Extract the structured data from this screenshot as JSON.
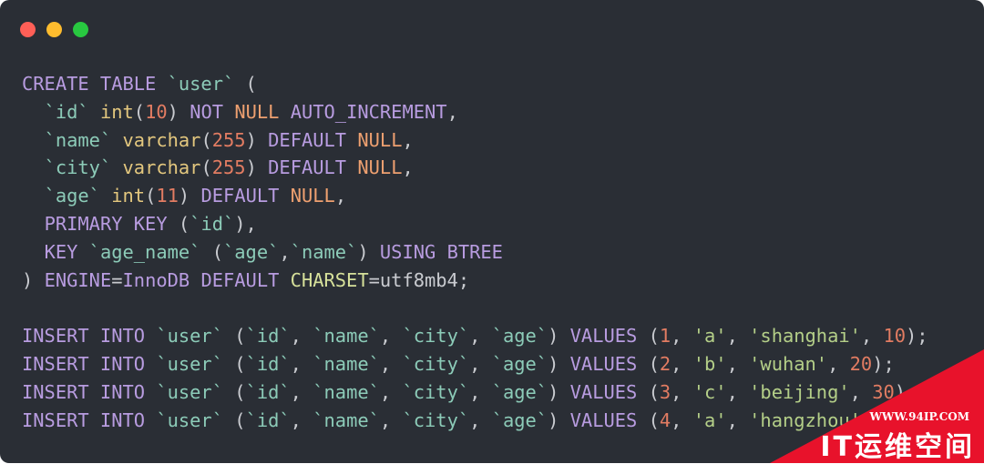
{
  "window": {
    "controls": [
      {
        "name": "close",
        "color": "#ff5f57"
      },
      {
        "name": "minimize",
        "color": "#febc2e"
      },
      {
        "name": "maximize",
        "color": "#28c840"
      }
    ]
  },
  "code": [
    [
      [
        "kw",
        "CREATE TABLE "
      ],
      [
        "id",
        "`user`"
      ],
      [
        "p",
        " ("
      ]
    ],
    [
      [
        "p",
        "  "
      ],
      [
        "id",
        "`id`"
      ],
      [
        "p",
        " "
      ],
      [
        "ty",
        "int"
      ],
      [
        "p",
        "("
      ],
      [
        "num",
        "10"
      ],
      [
        "p",
        ") "
      ],
      [
        "kw",
        "NOT "
      ],
      [
        "nul",
        "NULL"
      ],
      [
        "kw",
        " AUTO_INCREMENT"
      ],
      [
        "p",
        ","
      ]
    ],
    [
      [
        "p",
        "  "
      ],
      [
        "id",
        "`name`"
      ],
      [
        "p",
        " "
      ],
      [
        "ty",
        "varchar"
      ],
      [
        "p",
        "("
      ],
      [
        "num",
        "255"
      ],
      [
        "p",
        ") "
      ],
      [
        "kw",
        "DEFAULT "
      ],
      [
        "nul",
        "NULL"
      ],
      [
        "p",
        ","
      ]
    ],
    [
      [
        "p",
        "  "
      ],
      [
        "id",
        "`city`"
      ],
      [
        "p",
        " "
      ],
      [
        "ty",
        "varchar"
      ],
      [
        "p",
        "("
      ],
      [
        "num",
        "255"
      ],
      [
        "p",
        ") "
      ],
      [
        "kw",
        "DEFAULT "
      ],
      [
        "nul",
        "NULL"
      ],
      [
        "p",
        ","
      ]
    ],
    [
      [
        "p",
        "  "
      ],
      [
        "id",
        "`age`"
      ],
      [
        "p",
        " "
      ],
      [
        "ty",
        "int"
      ],
      [
        "p",
        "("
      ],
      [
        "num",
        "11"
      ],
      [
        "p",
        ") "
      ],
      [
        "kw",
        "DEFAULT "
      ],
      [
        "nul",
        "NULL"
      ],
      [
        "p",
        ","
      ]
    ],
    [
      [
        "p",
        "  "
      ],
      [
        "kw",
        "PRIMARY KEY"
      ],
      [
        "p",
        " ("
      ],
      [
        "id",
        "`id`"
      ],
      [
        "p",
        "),"
      ]
    ],
    [
      [
        "p",
        "  "
      ],
      [
        "kw",
        "KEY "
      ],
      [
        "id",
        "`age_name`"
      ],
      [
        "p",
        " ("
      ],
      [
        "id",
        "`age`"
      ],
      [
        "p",
        ","
      ],
      [
        "id",
        "`name`"
      ],
      [
        "p",
        ") "
      ],
      [
        "kw",
        "USING BTREE"
      ]
    ],
    [
      [
        "p",
        ") "
      ],
      [
        "kw",
        "ENGINE"
      ],
      [
        "p",
        "="
      ],
      [
        "kw",
        "InnoDB DEFAULT "
      ],
      [
        "cs",
        "CHARSET"
      ],
      [
        "p",
        "=utf8mb4;"
      ]
    ],
    [],
    [
      [
        "kw",
        "INSERT INTO "
      ],
      [
        "id",
        "`user`"
      ],
      [
        "p",
        " ("
      ],
      [
        "id",
        "`id`"
      ],
      [
        "p",
        ", "
      ],
      [
        "id",
        "`name`"
      ],
      [
        "p",
        ", "
      ],
      [
        "id",
        "`city`"
      ],
      [
        "p",
        ", "
      ],
      [
        "id",
        "`age`"
      ],
      [
        "p",
        ") "
      ],
      [
        "kw",
        "VALUES"
      ],
      [
        "p",
        " ("
      ],
      [
        "num",
        "1"
      ],
      [
        "p",
        ", "
      ],
      [
        "str",
        "'a'"
      ],
      [
        "p",
        ", "
      ],
      [
        "str",
        "'shanghai'"
      ],
      [
        "p",
        ", "
      ],
      [
        "num",
        "10"
      ],
      [
        "p",
        ");"
      ]
    ],
    [
      [
        "kw",
        "INSERT INTO "
      ],
      [
        "id",
        "`user`"
      ],
      [
        "p",
        " ("
      ],
      [
        "id",
        "`id`"
      ],
      [
        "p",
        ", "
      ],
      [
        "id",
        "`name`"
      ],
      [
        "p",
        ", "
      ],
      [
        "id",
        "`city`"
      ],
      [
        "p",
        ", "
      ],
      [
        "id",
        "`age`"
      ],
      [
        "p",
        ") "
      ],
      [
        "kw",
        "VALUES"
      ],
      [
        "p",
        " ("
      ],
      [
        "num",
        "2"
      ],
      [
        "p",
        ", "
      ],
      [
        "str",
        "'b'"
      ],
      [
        "p",
        ", "
      ],
      [
        "str",
        "'wuhan'"
      ],
      [
        "p",
        ", "
      ],
      [
        "num",
        "20"
      ],
      [
        "p",
        ");"
      ]
    ],
    [
      [
        "kw",
        "INSERT INTO "
      ],
      [
        "id",
        "`user`"
      ],
      [
        "p",
        " ("
      ],
      [
        "id",
        "`id`"
      ],
      [
        "p",
        ", "
      ],
      [
        "id",
        "`name`"
      ],
      [
        "p",
        ", "
      ],
      [
        "id",
        "`city`"
      ],
      [
        "p",
        ", "
      ],
      [
        "id",
        "`age`"
      ],
      [
        "p",
        ") "
      ],
      [
        "kw",
        "VALUES"
      ],
      [
        "p",
        " ("
      ],
      [
        "num",
        "3"
      ],
      [
        "p",
        ", "
      ],
      [
        "str",
        "'c'"
      ],
      [
        "p",
        ", "
      ],
      [
        "str",
        "'beijing'"
      ],
      [
        "p",
        ", "
      ],
      [
        "num",
        "30"
      ],
      [
        "p",
        ");"
      ]
    ],
    [
      [
        "kw",
        "INSERT INTO "
      ],
      [
        "id",
        "`user`"
      ],
      [
        "p",
        " ("
      ],
      [
        "id",
        "`id`"
      ],
      [
        "p",
        ", "
      ],
      [
        "id",
        "`name`"
      ],
      [
        "p",
        ", "
      ],
      [
        "id",
        "`city`"
      ],
      [
        "p",
        ", "
      ],
      [
        "id",
        "`age`"
      ],
      [
        "p",
        ") "
      ],
      [
        "kw",
        "VALUES"
      ],
      [
        "p",
        " ("
      ],
      [
        "num",
        "4"
      ],
      [
        "p",
        ", "
      ],
      [
        "str",
        "'a'"
      ],
      [
        "p",
        ", "
      ],
      [
        "str",
        "'hangzhou'"
      ],
      [
        "p",
        ", "
      ],
      [
        "num",
        "20"
      ],
      [
        "p",
        ");"
      ]
    ]
  ],
  "watermark": {
    "url": "WWW.94IP.COM",
    "name": "IT运维空间"
  }
}
